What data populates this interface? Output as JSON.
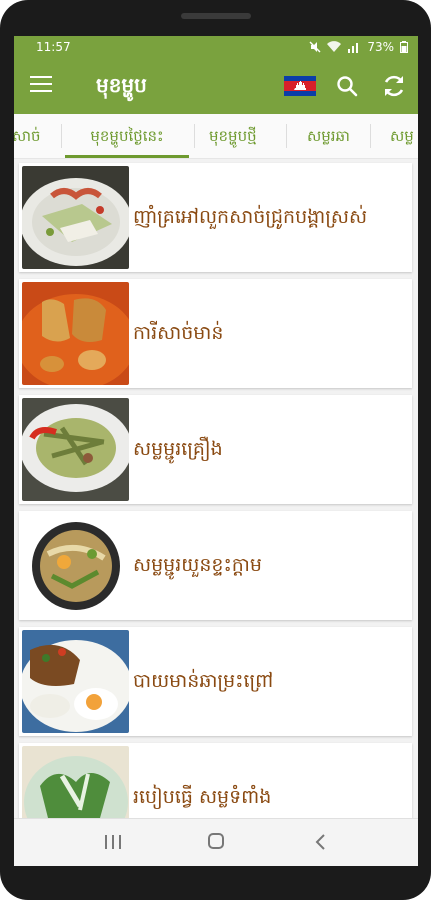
{
  "status": {
    "time": "11:57",
    "battery": "73%"
  },
  "app": {
    "title": "មុខម្ហូប",
    "accent_color": "#7aa23e"
  },
  "toolbar": {
    "menu_icon": "hamburger-menu-icon",
    "flag_icon": "cambodia-flag-icon",
    "search_icon": "search-icon",
    "refresh_icon": "refresh-icon"
  },
  "tabs": [
    {
      "label": "សាច់"
    },
    {
      "label": "មុខម្ហូបថ្ងៃនេះ",
      "active": true
    },
    {
      "label": "មុខម្ហូបថ្មី"
    },
    {
      "label": "សម្លរឆា"
    },
    {
      "label": "សម្ល"
    }
  ],
  "recipes": [
    {
      "title": "ញាំគ្រអៅលួកសាច់ជ្រូកបង្គាស្រស់"
    },
    {
      "title": "ការីសាច់មាន់"
    },
    {
      "title": "សម្លម្ជូរគ្រឿង"
    },
    {
      "title": "សម្លម្ជូរយួនខ្ទះក្តាម"
    },
    {
      "title": "បាយមាន់ឆាម្រះព្រៅ"
    },
    {
      "title": "របៀបធ្វើ សម្លទំពាំង"
    }
  ],
  "navbar": {
    "recents_icon": "recents-icon",
    "home_icon": "home-icon",
    "back_icon": "back-icon"
  }
}
